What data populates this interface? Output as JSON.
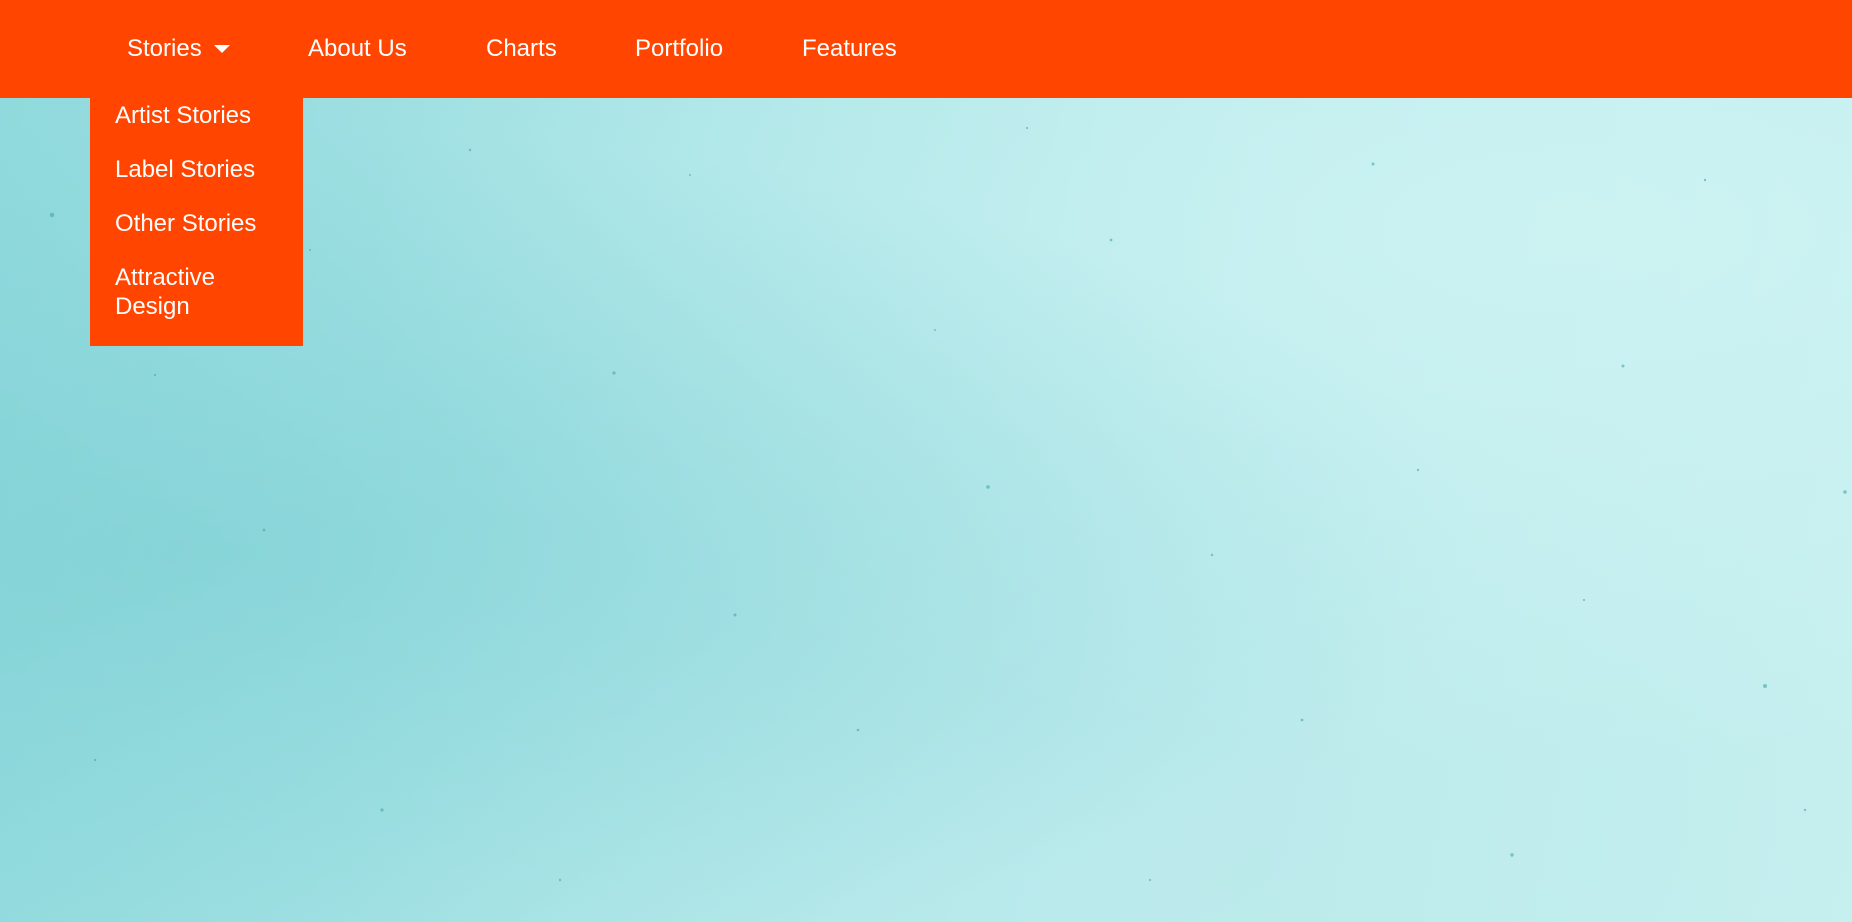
{
  "colors": {
    "navbar": "#ff4500",
    "text": "#ffffff",
    "background": "#aee5e7"
  },
  "nav": {
    "items": [
      {
        "label": "Stories",
        "icon": "caret-down-icon"
      },
      {
        "label": "About Us"
      },
      {
        "label": "Charts"
      },
      {
        "label": "Portfolio"
      },
      {
        "label": "Features"
      }
    ]
  },
  "dropdown": {
    "items": [
      {
        "label": "Artist Stories"
      },
      {
        "label": "Label Stories"
      },
      {
        "label": "Other Stories"
      },
      {
        "label": "Attractive Design"
      }
    ]
  }
}
